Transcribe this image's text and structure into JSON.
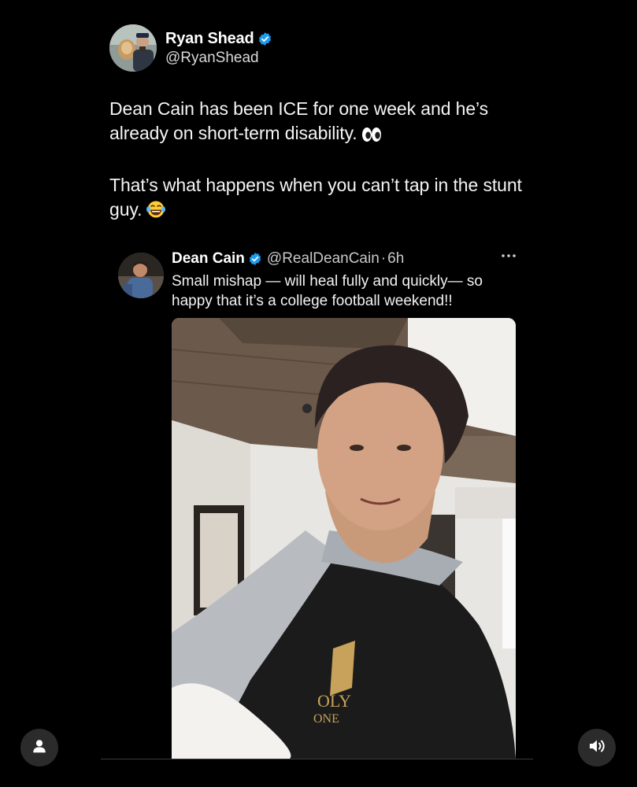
{
  "post": {
    "author_name": "Ryan Shead",
    "author_handle": "@RyanShead",
    "text_paragraph_1": "Dean Cain has been ICE for one week and he’s already on short-term disability.",
    "text_paragraph_1_emoji": "eyes-emoji",
    "text_paragraph_2": "That’s what happens when you can’t tap in the stunt guy.",
    "text_paragraph_2_emoji": "laughing-tears-emoji"
  },
  "quoted_post": {
    "author_name": "Dean Cain",
    "author_handle": "@RealDeanCain",
    "separator": "·",
    "time_ago": "6h",
    "text": "Small mishap — will heal fully and quickly— so happy that it’s a college football weekend!!",
    "image_alt_shirt_text": "OLY ONE"
  },
  "controls": {
    "profile_icon": "person-icon",
    "sound_icon": "speaker-icon",
    "more_icon": "more-horizontal-icon"
  },
  "colors": {
    "background": "#000000",
    "verified_blue": "#1d9bf0",
    "text_primary": "#ffffff",
    "text_secondary": "#c8c8c8",
    "button_bg": "#2b2b2b"
  }
}
